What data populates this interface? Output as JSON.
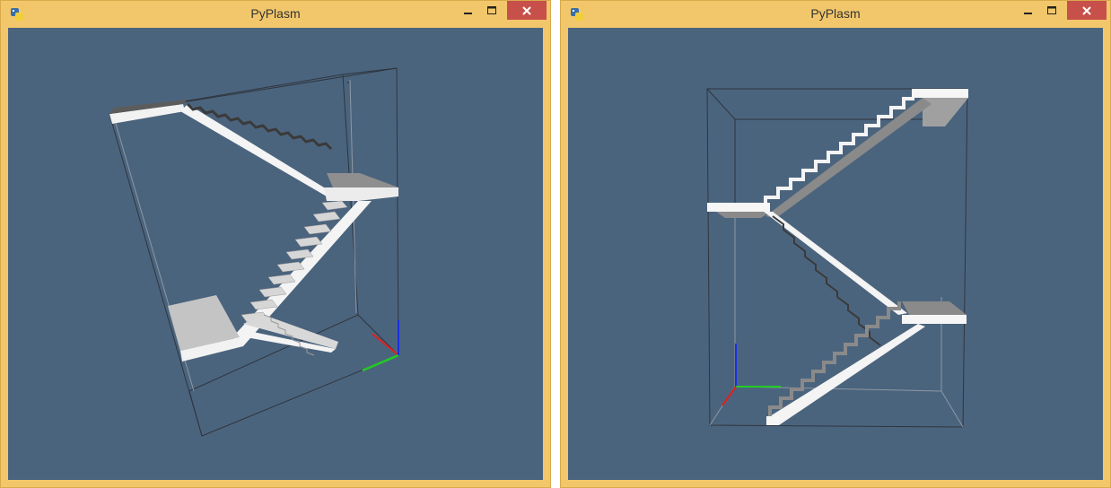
{
  "windows": [
    {
      "title": "PyPlasm",
      "icon": "python-icon",
      "controls": [
        "minimize-icon",
        "maximize-icon",
        "close-icon"
      ],
      "viewport_background": "#4b647e"
    },
    {
      "title": "PyPlasm",
      "icon": "python-icon",
      "controls": [
        "minimize-icon",
        "maximize-icon",
        "close-icon"
      ],
      "viewport_background": "#4b647e"
    }
  ],
  "colors": {
    "frame": "#f2c76b",
    "close_button": "#c7504a",
    "axis_x": "#e02020",
    "axis_y": "#22cc22",
    "axis_z": "#1a2ee0",
    "stair_light": "#f4f4f4",
    "stair_mid": "#bdbdbd",
    "stair_dark": "#8a8a8a",
    "box_edge": "#2a2f36"
  }
}
